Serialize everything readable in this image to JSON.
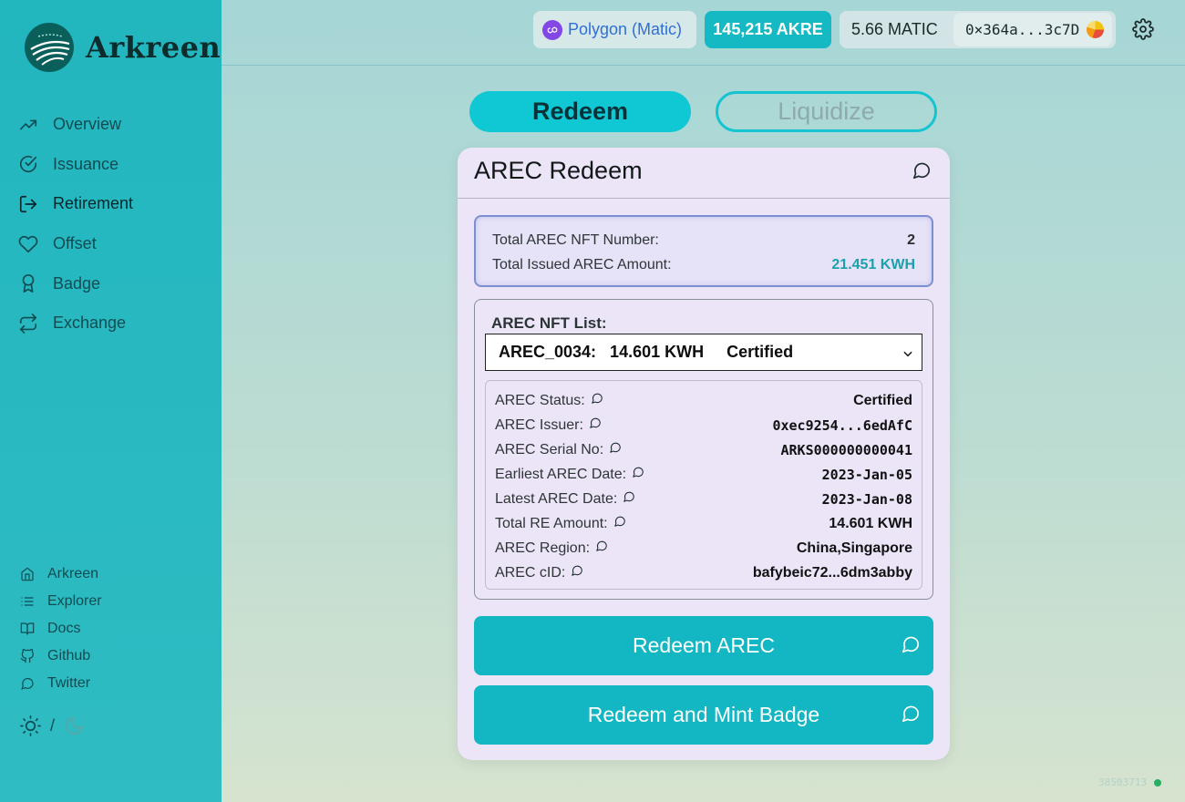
{
  "brand": {
    "name": "Arkreen"
  },
  "nav": [
    {
      "label": "Overview",
      "icon": "trending-up-icon"
    },
    {
      "label": "Issuance",
      "icon": "check-circle-icon"
    },
    {
      "label": "Retirement",
      "icon": "log-out-icon",
      "active": true
    },
    {
      "label": "Offset",
      "icon": "heart-icon"
    },
    {
      "label": "Badge",
      "icon": "award-icon"
    },
    {
      "label": "Exchange",
      "icon": "repeat-icon"
    }
  ],
  "links": [
    {
      "label": "Arkreen",
      "icon": "home-icon"
    },
    {
      "label": "Explorer",
      "icon": "list-icon"
    },
    {
      "label": "Docs",
      "icon": "book-icon"
    },
    {
      "label": "Github",
      "icon": "github-icon"
    },
    {
      "label": "Twitter",
      "icon": "message-circle-icon"
    }
  ],
  "theme": {
    "separator": "/"
  },
  "header": {
    "network": "Polygon (Matic)",
    "akre_balance": "145,215 AKRE",
    "matic_balance": "5.66 MATIC",
    "address": "0×364a...3c7D"
  },
  "tabs": {
    "redeem": "Redeem",
    "liquidize": "Liquidize"
  },
  "card": {
    "title": "AREC Redeem",
    "summary": [
      {
        "label": "Total AREC NFT Number:",
        "value": "2"
      },
      {
        "label": "Total Issued AREC Amount:",
        "value": "21.451 KWH"
      }
    ],
    "nft_list_label": "AREC NFT List:",
    "selected_nft": "AREC_0034:   14.601 KWH     Certified",
    "details": [
      {
        "label": "AREC Status:",
        "value": "Certified"
      },
      {
        "label": "AREC Issuer:",
        "value": "0xec9254...6edAfC"
      },
      {
        "label": "AREC Serial No:",
        "value": "ARKS000000000041"
      },
      {
        "label": "Earliest AREC Date:",
        "value": "2023-Jan-05"
      },
      {
        "label": "Latest AREC Date:",
        "value": "2023-Jan-08"
      },
      {
        "label": "Total RE Amount:",
        "value": "14.601 KWH"
      },
      {
        "label": "AREC Region:",
        "value": "China,Singapore"
      },
      {
        "label": "AREC cID:",
        "value": "bafybeic72...6dm3abby"
      }
    ],
    "actions": {
      "redeem": "Redeem AREC",
      "redeem_mint": "Redeem and Mint Badge"
    }
  },
  "footer": {
    "block_number": "38503713"
  }
}
